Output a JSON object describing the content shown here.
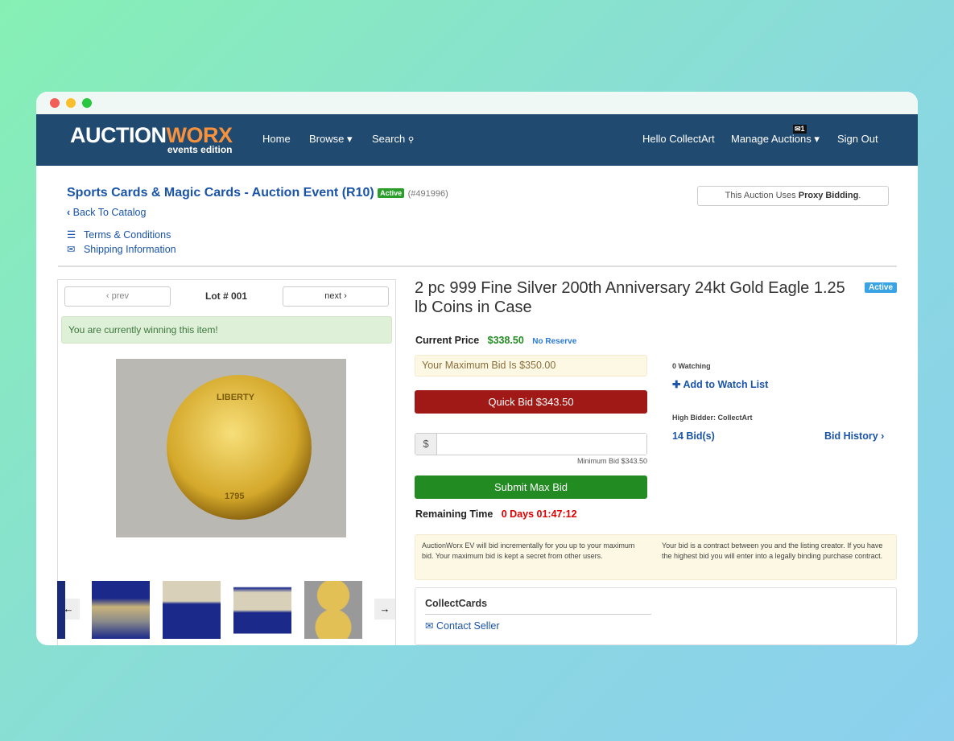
{
  "nav": {
    "logo_a": "AUCTION",
    "logo_b": "WORX",
    "logo_sub": "events edition",
    "home": "Home",
    "browse": "Browse",
    "search": "Search",
    "hello": "Hello CollectArt",
    "manage": "Manage Auctions",
    "mail_count": "1",
    "signout": "Sign Out"
  },
  "event": {
    "title": "Sports Cards & Magic Cards - Auction Event (R10)",
    "status": "Active",
    "id": "(#491996)",
    "back": "Back To Catalog",
    "terms": "Terms & Conditions",
    "shipping": "Shipping Information",
    "proxy_prefix": "This Auction Uses ",
    "proxy_bold": "Proxy Bidding",
    "proxy_suffix": "."
  },
  "lot": {
    "prev": "prev",
    "next": "next",
    "lot_no": "Lot # 001",
    "winning": "You are currently winning this item!",
    "coin_top": "LIBERTY",
    "coin_year": "1795"
  },
  "item": {
    "title": "2 pc 999 Fine Silver 200th Anniversary 24kt Gold Eagle 1.25 lb Coins in Case",
    "status": "Active",
    "price_label": "Current Price",
    "price": "$338.50",
    "reserve": "No Reserve",
    "max_bid": "Your Maximum Bid Is $350.00",
    "quick_bid": "Quick Bid $343.50",
    "currency": "$",
    "bid_value": "",
    "min_bid": "Minimum Bid $343.50",
    "submit": "Submit Max Bid",
    "remaining_label": "Remaining Time",
    "remaining": "0 Days 01:47:12",
    "watching": "0 Watching",
    "watch": "Add to Watch List",
    "high_bidder": "High Bidder: CollectArt",
    "bids": "14 Bid(s)",
    "history": "Bid History",
    "info_left": "AuctionWorx EV will bid incrementally for you up to your maximum bid. Your maximum bid is kept a secret from other users.",
    "info_right": "Your bid is a contract between you and the listing creator. If you have the highest bid you will enter into a legally binding purchase contract.",
    "seller": "CollectCards",
    "contact": "Contact Seller"
  },
  "colors": {
    "nav": "#204a6f",
    "accent": "#f7913c",
    "link": "#1a54a8",
    "quick_bid": "#a11916",
    "submit": "#228b22",
    "active": "#2a9d2a",
    "active_item": "#3aa3e3",
    "time": "#e00000"
  }
}
